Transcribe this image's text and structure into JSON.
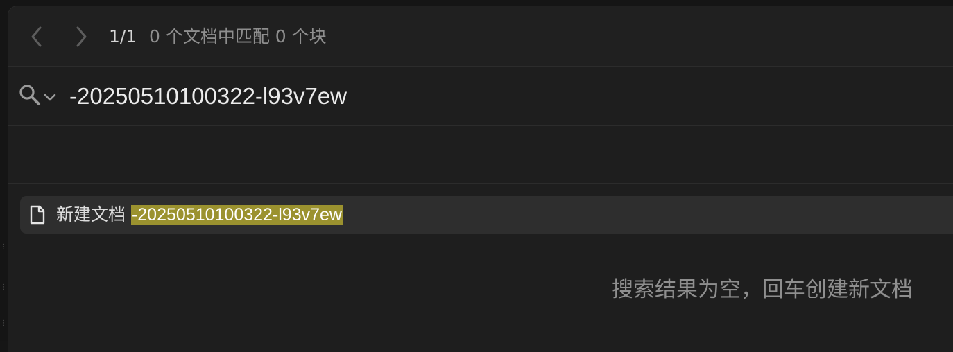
{
  "toolbar": {
    "back_icon": "chevron-left-icon",
    "forward_icon": "chevron-right-icon",
    "pager": "1/1",
    "match_info": "0 个文档中匹配 0 个块"
  },
  "search": {
    "icon": "search-icon",
    "method_icon": "chevron-down-icon",
    "value": "-20250510100322-l93v7ew"
  },
  "result": {
    "icon": "document-icon",
    "prefix": "新建文档 ",
    "highlight": "-20250510100322-l93v7ew"
  },
  "empty_hint": "搜索结果为空，回车创建新文档",
  "colors": {
    "panel_bg": "#1e1e1e",
    "result_bg": "#2e2e2e",
    "highlight_bg": "#9b922f",
    "muted_text": "#8e8e8e"
  }
}
